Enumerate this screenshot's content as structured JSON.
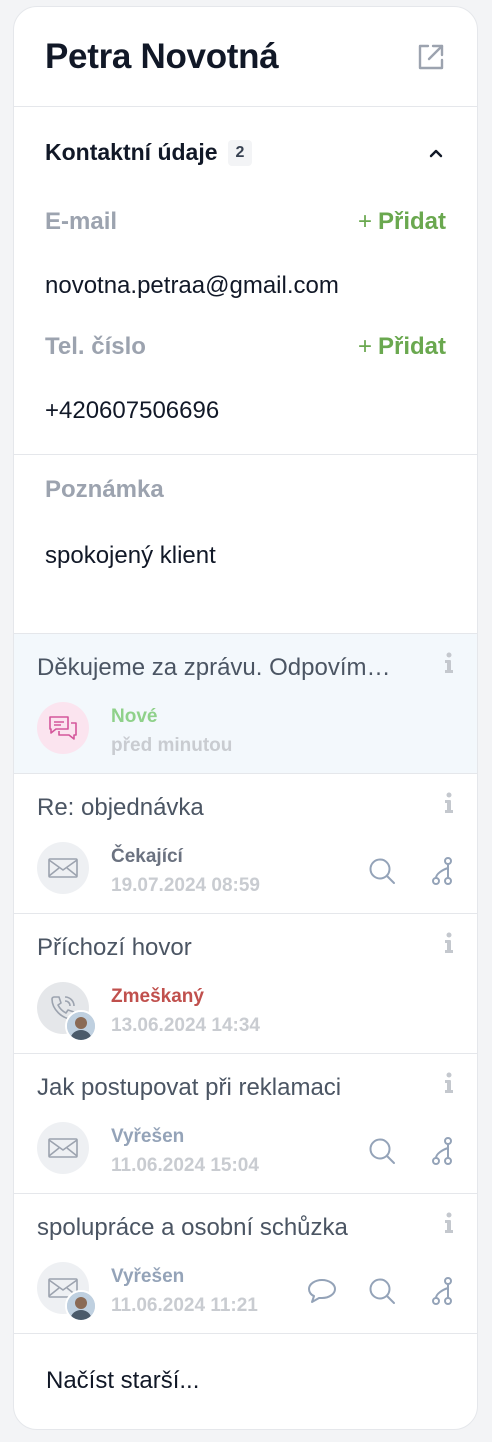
{
  "contact": {
    "name": "Petra Novotná",
    "section_title": "Kontaktní údaje",
    "section_count": "2",
    "email_label": "E-mail",
    "email_value": "novotna.petraa@gmail.com",
    "phone_label": "Tel. číslo",
    "phone_value": "+420607506696",
    "add_label": "Přidat",
    "add_plus": "+",
    "note_label": "Poznámka",
    "note_value": "spokojený klient"
  },
  "colors": {
    "green": "#6aa84f",
    "new": "#8fd18a",
    "waiting": "#6b7280",
    "missed": "#c0504d",
    "resolved": "#94a3b8"
  },
  "conversations": [
    {
      "title": "Děkujeme za zprávu. Odpovím…",
      "status": "Nové",
      "date": "před minutou",
      "icon": "chat-bubbles-icon"
    },
    {
      "title": "Re: objednávka",
      "status": "Čekající",
      "date": "19.07.2024 08:59",
      "icon": "envelope-icon"
    },
    {
      "title": "Příchozí hovor",
      "status": "Zmeškaný",
      "date": "13.06.2024 14:34",
      "icon": "phone-icon"
    },
    {
      "title": "Jak postupovat při reklamaci",
      "status": "Vyřešen",
      "date": "11.06.2024 15:04",
      "icon": "envelope-icon"
    },
    {
      "title": "spolupráce a osobní schůzka",
      "status": "Vyřešen",
      "date": "11.06.2024 11:21",
      "icon": "envelope-icon"
    }
  ],
  "load_older": "Načíst starší..."
}
